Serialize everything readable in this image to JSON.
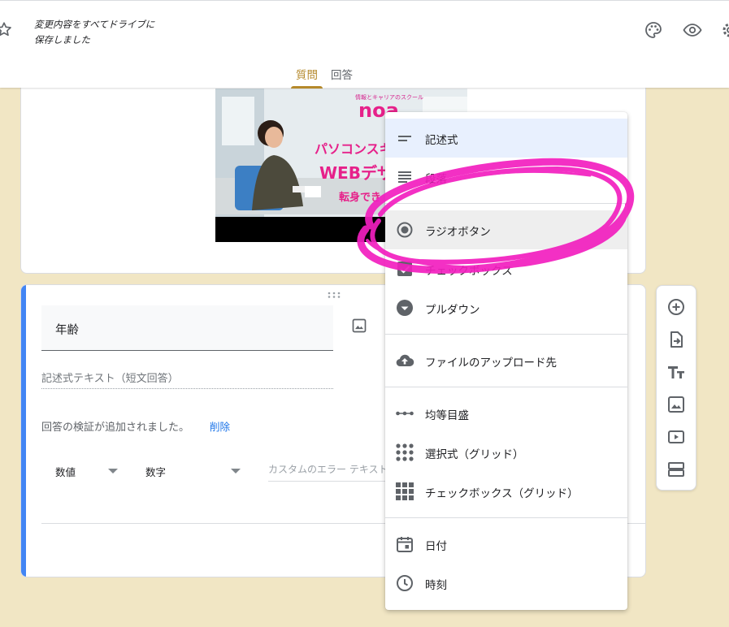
{
  "header": {
    "save_status_line1": "変更内容をすべてドライブに",
    "save_status_line2": "保存しました",
    "tabs": [
      {
        "label": "質問",
        "active": true
      },
      {
        "label": "回答",
        "active": false
      }
    ],
    "icons": [
      "star-icon",
      "palette-icon",
      "eye-icon",
      "gear-icon"
    ]
  },
  "image_card": {
    "photo": {
      "brand_small": "情報とキャリアのスクール",
      "brand_logo": "noa",
      "line1": "パソコンスキ",
      "line2": "WEBデザ",
      "line3": "転身でき"
    }
  },
  "question": {
    "title": "年齢",
    "answer_placeholder": "記述式テキスト（短文回答）",
    "validation_text": "回答の検証が追加されました。",
    "delete_label": "削除",
    "validation_type": "数値",
    "validation_condition": "数字",
    "error_placeholder": "カスタムのエラー テキスト"
  },
  "dropdown": {
    "items": [
      {
        "label": "記述式",
        "icon": "short-answer-icon"
      },
      {
        "label": "段落",
        "icon": "paragraph-icon"
      },
      {
        "label": "ラジオボタン",
        "icon": "radio-button-icon"
      },
      {
        "label": "チェックボックス",
        "icon": "checkbox-icon"
      },
      {
        "label": "プルダウン",
        "icon": "dropdown-icon"
      },
      {
        "label": "ファイルのアップロード先",
        "icon": "cloud-upload-icon"
      },
      {
        "label": "均等目盛",
        "icon": "linear-scale-icon"
      },
      {
        "label": "選択式（グリッド）",
        "icon": "grid-dots-icon"
      },
      {
        "label": "チェックボックス（グリッド）",
        "icon": "grid-squares-icon"
      },
      {
        "label": "日付",
        "icon": "calendar-icon"
      },
      {
        "label": "時刻",
        "icon": "clock-icon"
      }
    ]
  },
  "side_toolbar": {
    "icons": [
      "add-question-icon",
      "import-questions-icon",
      "add-title-icon",
      "add-image-icon",
      "add-video-icon",
      "add-section-icon"
    ]
  },
  "colors": {
    "background": "#f1e6c4",
    "accent": "#b5892b",
    "question_bar": "#4285f4",
    "link": "#1a73e8",
    "highlight": "#f21fbf"
  }
}
